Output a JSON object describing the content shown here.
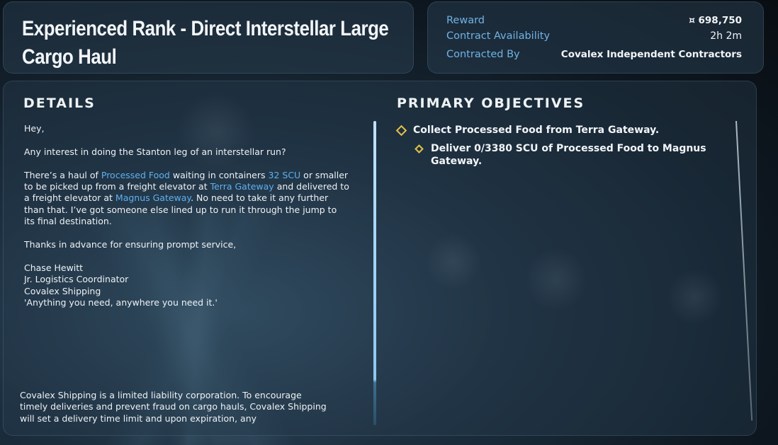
{
  "contract": {
    "title": "Experienced Rank - Direct Interstellar Large Cargo Haul"
  },
  "info": {
    "reward_label": "Reward",
    "reward_value": "¤ 698,750",
    "availability_label": "Contract Availability",
    "availability_value": "2h 2m",
    "contracted_by_label": "Contracted By",
    "contracted_by_value": "Covalex Independent Contractors"
  },
  "details": {
    "heading": "DETAILS",
    "greeting": "Hey,",
    "question": "Any interest in doing the Stanton leg of an interstellar run?",
    "para_a1": "There’s a haul of ",
    "commodity": "Processed Food",
    "para_a2": " waiting in containers ",
    "container_size": "32 SCU",
    "para_a3": " or smaller to be picked up from a freight elevator at ",
    "pickup": "Terra Gateway",
    "para_a4": " and delivered to a freight elevator at ",
    "dropoff": "Magnus Gateway",
    "para_a5": ". No need to take it any further than that. I’ve got someone else lined up to run it through the jump to its final destination.",
    "thanks": "Thanks in advance for ensuring prompt service,",
    "signature_name": "Chase Hewitt",
    "signature_role": "Jr. Logistics Coordinator",
    "signature_company": "Covalex Shipping",
    "signature_motto": "'Anything you need, anywhere you need it.'",
    "legal": "Covalex Shipping is a limited liability corporation. To encourage timely deliveries and prevent fraud on cargo hauls, Covalex Shipping will set a delivery time limit and upon expiration, any"
  },
  "objectives": {
    "heading": "PRIMARY OBJECTIVES",
    "items": [
      {
        "text": "Collect Processed Food from Terra Gateway."
      },
      {
        "text": "Deliver 0/3380 SCU of Processed Food to Magnus Gateway."
      }
    ]
  },
  "colors": {
    "highlight": "#5fb0f0",
    "label": "#6fb3e6",
    "objective_marker": "#e8c24a"
  },
  "icons": {
    "currency": "currency-icon",
    "objective": "diamond-icon"
  }
}
